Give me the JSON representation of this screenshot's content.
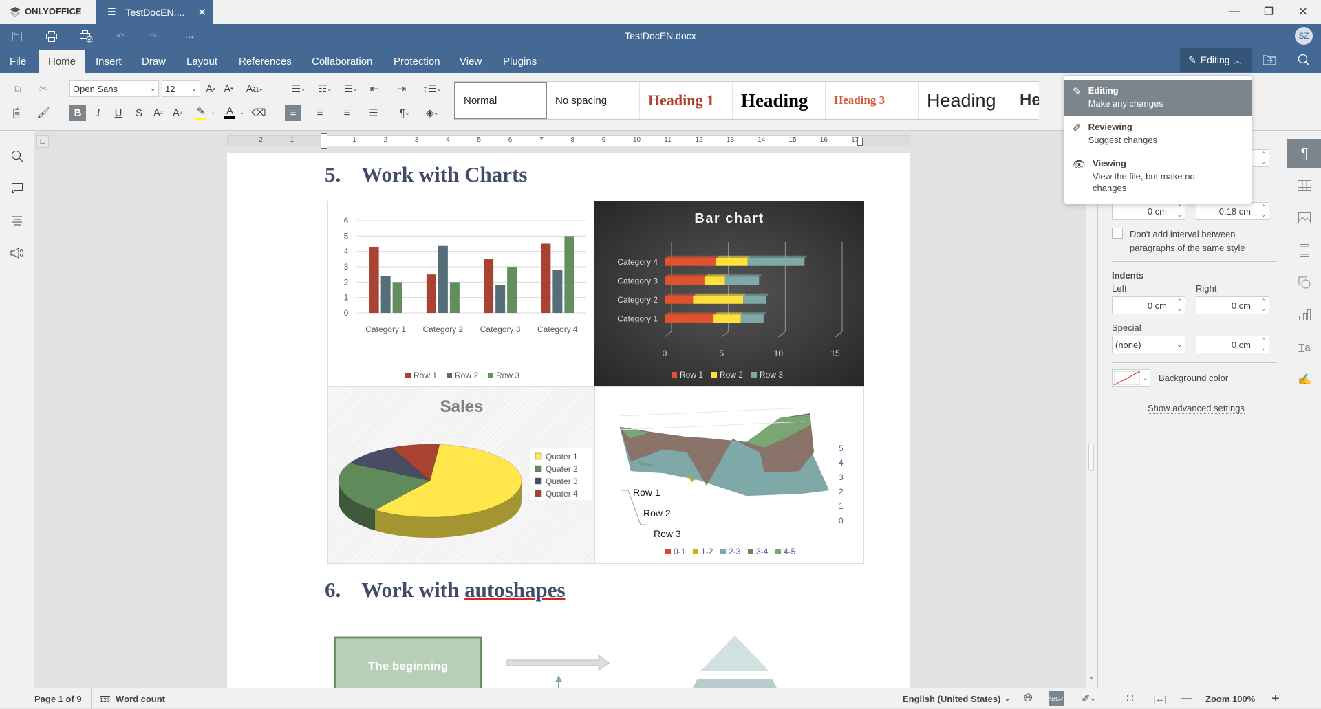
{
  "app": {
    "brand": "ONLYOFFICE",
    "tab_title": "TestDocEN....",
    "doc_title": "TestDocEN.docx",
    "avatar_initials": "SZ"
  },
  "menu": {
    "tabs": [
      "File",
      "Home",
      "Insert",
      "Draw",
      "Layout",
      "References",
      "Collaboration",
      "Protection",
      "View",
      "Plugins"
    ],
    "active": "Home",
    "mode_button": "Editing"
  },
  "toolbar": {
    "font_name": "Open Sans",
    "font_size": "12",
    "styles": [
      "Normal",
      "No spacing",
      "Heading 1",
      "Heading",
      "Heading 3",
      "Heading",
      "Headi"
    ],
    "highlight_color": "#ffff00",
    "font_color": "#000000"
  },
  "mode_menu": {
    "items": [
      {
        "title": "Editing",
        "desc": "Make any changes",
        "selected": true
      },
      {
        "title": "Reviewing",
        "desc": "Suggest changes",
        "selected": false
      },
      {
        "title": "Viewing",
        "desc": "View the file, but make no changes",
        "selected": false
      }
    ]
  },
  "right_panel": {
    "spacing_before": "0 cm",
    "spacing_after": "0.18 cm",
    "dont_add_interval": "Don't add interval between paragraphs of the same style",
    "indents_title": "Indents",
    "left_label": "Left",
    "right_label": "Right",
    "left_value": "0 cm",
    "right_value": "0 cm",
    "special_label": "Special",
    "special_value": "(none)",
    "special_by": "0 cm",
    "background_color_label": "Background color",
    "advanced_link": "Show advanced settings"
  },
  "document": {
    "heading5_num": "5.",
    "heading5_text": "Work with Charts",
    "heading6_num": "6.",
    "heading6_text_a": "Work with ",
    "heading6_text_b": "autoshapes",
    "shape_text": "The beginning",
    "ruler_labels": [
      "2",
      "1",
      "1",
      "2",
      "3",
      "4",
      "5",
      "6",
      "7",
      "8",
      "9",
      "10",
      "11",
      "12",
      "13",
      "14",
      "15",
      "16",
      "17"
    ]
  },
  "status": {
    "page": "Page 1 of 9",
    "word_count": "Word count",
    "language": "English (United States)",
    "zoom": "Zoom 100%"
  },
  "chart_data": [
    {
      "type": "bar",
      "title": "",
      "categories": [
        "Category 1",
        "Category 2",
        "Category 3",
        "Category 4"
      ],
      "series": [
        {
          "name": "Row 1",
          "values": [
            4.3,
            2.5,
            3.5,
            4.5
          ],
          "color": "#a84231"
        },
        {
          "name": "Row 2",
          "values": [
            2.4,
            4.4,
            1.8,
            2.8
          ],
          "color": "#566e7a"
        },
        {
          "name": "Row 3",
          "values": [
            2,
            2,
            3,
            5
          ],
          "color": "#638e5e"
        }
      ],
      "ylim": [
        0,
        6
      ],
      "yticks": [
        0,
        1,
        2,
        3,
        4,
        5,
        6
      ],
      "grid": true,
      "legend": "bottom"
    },
    {
      "type": "bar",
      "orientation": "horizontal-stacked",
      "title": "Bar chart",
      "categories": [
        "Category 1",
        "Category 2",
        "Category 3",
        "Category 4"
      ],
      "series": [
        {
          "name": "Row 1",
          "values": [
            4.3,
            2.5,
            3.5,
            4.5
          ],
          "color": "#e0522e"
        },
        {
          "name": "Row 2",
          "values": [
            2.4,
            4.4,
            1.8,
            2.8
          ],
          "color": "#ffe03c"
        },
        {
          "name": "Row 3",
          "values": [
            2,
            2,
            3,
            5
          ],
          "color": "#7fa8a8"
        }
      ],
      "xlim": [
        0,
        15
      ],
      "xticks": [
        0,
        5,
        10,
        15
      ],
      "legend": "bottom"
    },
    {
      "type": "pie",
      "title": "Sales",
      "labels": [
        "Quater 1",
        "Quater 2",
        "Quater 3",
        "Quater 4"
      ],
      "values": [
        8.2,
        3.2,
        1.4,
        1.2
      ],
      "colors": [
        "#ffe64a",
        "#5f8a59",
        "#484d63",
        "#a84231"
      ],
      "legend": "right"
    },
    {
      "type": "area",
      "subtype": "3d-surface",
      "title": "",
      "series_labels": [
        "Row 1",
        "Row 2",
        "Row 3"
      ],
      "zticks": [
        0,
        1,
        2,
        3,
        4,
        5
      ],
      "legend": [
        "0-1",
        "1-2",
        "2-3",
        "3-4",
        "4-5"
      ],
      "legend_colors": [
        "#d2492c",
        "#c8b400",
        "#7fa8a8",
        "#8a7369",
        "#79a672"
      ]
    }
  ]
}
